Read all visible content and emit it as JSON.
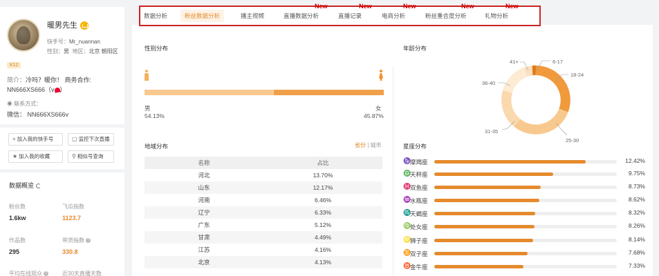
{
  "profile": {
    "name": "暖男先生",
    "id_label": "快手号：",
    "id_value": "Mr_nuannan",
    "gender_label": "性别：",
    "gender_value": "男",
    "region_label": "地区：",
    "region_value": "北京 朝阳区",
    "badge": "K12",
    "intro_label": "简介：",
    "intro_text": "冷吗？暖你！ 商务合作:",
    "intro_line2_a": "NN666XS666（v",
    "intro_line2_b": "）",
    "contact_label": "联系方式：",
    "wechat": "微信：  NN666XS666v"
  },
  "actions": {
    "add_kuaishou": "加入我的快手号",
    "monitor": "监控下次直播",
    "add_favorite": "加入我的收藏",
    "similar": "相似号查询"
  },
  "overview": {
    "title": "数据概览",
    "fans_label": "粉丝数",
    "fans_value": "1.6kw",
    "growth_label": "飞瓜指数",
    "growth_value": "1123.7",
    "works_label": "作品数",
    "works_value": "295",
    "goods_label": "带货指数",
    "goods_value": "330.8",
    "online_label": "平均在线观众",
    "live_label": "近30天直播天数"
  },
  "tabs": [
    {
      "label": "数据分析",
      "active": false,
      "new": false
    },
    {
      "label": "粉丝数据分析",
      "active": true,
      "new": false
    },
    {
      "label": "播主视频",
      "active": false,
      "new": false
    },
    {
      "label": "直播数据分析",
      "active": false,
      "new": true
    },
    {
      "label": "直播记录",
      "active": false,
      "new": true
    },
    {
      "label": "电商分析",
      "active": false,
      "new": true
    },
    {
      "label": "粉丝重合度分析",
      "active": false,
      "new": true
    },
    {
      "label": "礼物分析",
      "active": false,
      "new": true
    }
  ],
  "new_tag": "New",
  "gender": {
    "title": "性别分布",
    "male_label": "男",
    "male_pct": "54.13%",
    "male_value": 54.13,
    "female_label": "女",
    "female_pct": "45.87%",
    "male_color": "#f8c98e",
    "female_color": "#f0a04a"
  },
  "region": {
    "title": "地域分布",
    "toggle_province": "省份",
    "toggle_city": "城市",
    "col_name": "名称",
    "col_ratio": "占比",
    "rows": [
      {
        "name": "河北",
        "ratio": "13.70%"
      },
      {
        "name": "山东",
        "ratio": "12.17%"
      },
      {
        "name": "河南",
        "ratio": "6.46%"
      },
      {
        "name": "辽宁",
        "ratio": "6.33%"
      },
      {
        "name": "广东",
        "ratio": "5.12%"
      },
      {
        "name": "甘肃",
        "ratio": "4.49%"
      },
      {
        "name": "江苏",
        "ratio": "4.16%"
      },
      {
        "name": "北京",
        "ratio": "4.13%"
      }
    ]
  },
  "age": {
    "title": "年龄分布",
    "labels": [
      "6-17",
      "18-24",
      "25-30",
      "31-35",
      "36-40",
      "41+"
    ]
  },
  "zodiac": {
    "title": "星座分布",
    "accent": "#e58a2d",
    "items": [
      {
        "icon": "♑",
        "name": "摩羯座",
        "pct": "12.42%",
        "value": 12.42
      },
      {
        "icon": "♎",
        "name": "天秤座",
        "pct": "9.75%",
        "value": 9.75
      },
      {
        "icon": "♓",
        "name": "双鱼座",
        "pct": "8.73%",
        "value": 8.73
      },
      {
        "icon": "♒",
        "name": "水瓶座",
        "pct": "8.62%",
        "value": 8.62
      },
      {
        "icon": "♏",
        "name": "天蝎座",
        "pct": "8.32%",
        "value": 8.32
      },
      {
        "icon": "♍",
        "name": "处女座",
        "pct": "8.26%",
        "value": 8.26
      },
      {
        "icon": "♌",
        "name": "狮子座",
        "pct": "8.14%",
        "value": 8.14
      },
      {
        "icon": "♊",
        "name": "双子座",
        "pct": "7.68%",
        "value": 7.68
      },
      {
        "icon": "♉",
        "name": "金牛座",
        "pct": "7.33%",
        "value": 7.33
      }
    ]
  }
}
